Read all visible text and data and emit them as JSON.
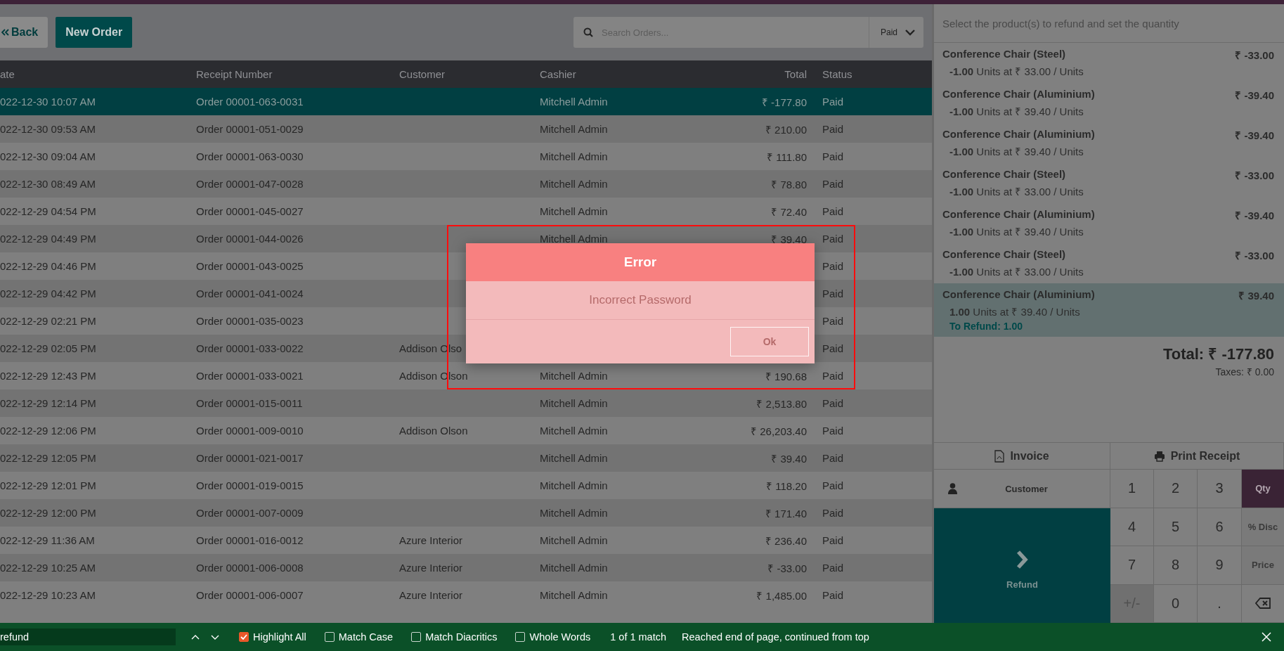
{
  "top_bar": {
    "back": "Back",
    "new_order": "New Order",
    "search": {
      "placeholder": "Search Orders..."
    },
    "filter": "Paid"
  },
  "table": {
    "columns": [
      "ate",
      "Receipt Number",
      "Customer",
      "Cashier",
      "Total",
      "Status"
    ],
    "rows": [
      {
        "date": "022-12-30 10:07 AM",
        "receipt": "Order 00001-063-0031",
        "cashier": "Mitchell Admin",
        "total": "₹ -177.80",
        "status": "Paid",
        "selected": true
      },
      {
        "date": "022-12-30 09:53 AM",
        "receipt": "Order 00001-051-0029",
        "cashier": "Mitchell Admin",
        "total": "₹ 210.00",
        "status": "Paid",
        "selected": false
      },
      {
        "date": "022-12-30 09:04 AM",
        "receipt": "Order 00001-063-0030",
        "cashier": "Mitchell Admin",
        "total": "₹ 111.80",
        "status": "Paid",
        "selected": false
      },
      {
        "date": "022-12-30 08:49 AM",
        "receipt": "Order 00001-047-0028",
        "cashier": "Mitchell Admin",
        "total": "₹ 78.80",
        "status": "Paid",
        "selected": false
      },
      {
        "date": "022-12-29 04:54 PM",
        "receipt": "Order 00001-045-0027",
        "cashier": "Mitchell Admin",
        "total": "₹ 72.40",
        "status": "Paid",
        "selected": false
      },
      {
        "date": "022-12-29 04:49 PM",
        "receipt": "Order 00001-044-0026",
        "cashier": "Mitchell Admin",
        "total": "₹ 39.40",
        "status": "Paid",
        "selected": false
      },
      {
        "date": "022-12-29 04:46 PM",
        "receipt": "Order 00001-043-0025",
        "status": "Paid",
        "selected": false
      },
      {
        "date": "022-12-29 04:42 PM",
        "receipt": "Order 00001-041-0024",
        "status": "Paid",
        "selected": false
      },
      {
        "date": "022-12-29 02:21 PM",
        "receipt": "Order 00001-035-0023",
        "status": "Paid",
        "selected": false
      },
      {
        "date": "022-12-29 02:05 PM",
        "receipt": "Order 00001-033-0022",
        "customer": "Addison Olso",
        "status": "Paid",
        "selected": false
      },
      {
        "date": "022-12-29 12:43 PM",
        "receipt": "Order 00001-033-0021",
        "customer": "Addison Olson",
        "cashier": "Mitchell Admin",
        "total": "₹ 190.68",
        "status": "Paid",
        "selected": false
      },
      {
        "date": "022-12-29 12:14 PM",
        "receipt": "Order 00001-015-0011",
        "cashier": "Mitchell Admin",
        "total": "₹ 2,513.80",
        "status": "Paid",
        "selected": false
      },
      {
        "date": "022-12-29 12:06 PM",
        "receipt": "Order 00001-009-0010",
        "customer": "Addison Olson",
        "cashier": "Mitchell Admin",
        "total": "₹ 26,203.40",
        "status": "Paid",
        "selected": false
      },
      {
        "date": "022-12-29 12:05 PM",
        "receipt": "Order 00001-021-0017",
        "cashier": "Mitchell Admin",
        "total": "₹ 39.40",
        "status": "Paid",
        "selected": false
      },
      {
        "date": "022-12-29 12:01 PM",
        "receipt": "Order 00001-019-0015",
        "cashier": "Mitchell Admin",
        "total": "₹ 118.20",
        "status": "Paid",
        "selected": false
      },
      {
        "date": "022-12-29 12:00 PM",
        "receipt": "Order 00001-007-0009",
        "cashier": "Mitchell Admin",
        "total": "₹ 171.40",
        "status": "Paid",
        "selected": false
      },
      {
        "date": "022-12-29 11:36 AM",
        "receipt": "Order 00001-016-0012",
        "customer": "Azure Interior",
        "cashier": "Mitchell Admin",
        "total": "₹ 236.40",
        "status": "Paid",
        "selected": false
      },
      {
        "date": "022-12-29 10:25 AM",
        "receipt": "Order 00001-006-0008",
        "customer": "Azure Interior",
        "cashier": "Mitchell Admin",
        "total": "₹ -33.00",
        "status": "Paid",
        "selected": false
      },
      {
        "date": "022-12-29 10:23 AM",
        "receipt": "Order 00001-006-0007",
        "customer": "Azure Interior",
        "cashier": "Mitchell Admin",
        "total": "₹ 1,485.00",
        "status": "Paid",
        "selected": false
      }
    ]
  },
  "dialog": {
    "title": "Error",
    "body": "Incorrect Password",
    "button": "Ok"
  },
  "refund_panel": {
    "instruction": "Select the product(s) to refund and set the quantity",
    "lines": [
      {
        "product": "Conference Chair (Steel)",
        "price": "₹ -33.00",
        "detail": "**-1.00** Units at ₹ 33.00 / Units",
        "selected": false
      },
      {
        "product": "Conference Chair (Aluminium)",
        "price": "₹ -39.40",
        "detail": "**-1.00** Units at ₹ 39.40 / Units",
        "selected": false
      },
      {
        "product": "Conference Chair (Aluminium)",
        "price": "₹ -39.40",
        "detail": "**-1.00** Units at ₹ 39.40 / Units",
        "selected": false
      },
      {
        "product": "Conference Chair (Steel)",
        "price": "₹ -33.00",
        "detail": "**-1.00** Units at ₹ 33.00 / Units",
        "selected": false
      },
      {
        "product": "Conference Chair (Aluminium)",
        "price": "₹ -39.40",
        "detail": "**-1.00** Units at ₹ 39.40 / Units",
        "selected": false
      },
      {
        "product": "Conference Chair (Steel)",
        "price": "₹ -33.00",
        "detail": "**-1.00** Units at ₹ 33.00 / Units",
        "selected": false
      },
      {
        "product": "Conference Chair (Aluminium)",
        "price": "₹ 39.40",
        "detail": "**1.00** Units at ₹ 39.40 / Units",
        "to_refund": "To Refund: 1.00",
        "selected": true
      }
    ],
    "total": "Total: ₹ -177.80",
    "taxes": "Taxes: ₹ 0.00",
    "invoice": "Invoice",
    "print_receipt": "Print Receipt",
    "customer": "Customer",
    "refund": "Refund",
    "keys": [
      {
        "kind": "digit",
        "label": "1"
      },
      {
        "kind": "digit",
        "label": "2"
      },
      {
        "kind": "digit",
        "label": "3"
      },
      {
        "kind": "mode",
        "label": "Qty",
        "selected": true
      },
      {
        "kind": "digit",
        "label": "4"
      },
      {
        "kind": "digit",
        "label": "5"
      },
      {
        "kind": "digit",
        "label": "6"
      },
      {
        "kind": "mode",
        "label": "% Disc",
        "selected": false
      },
      {
        "kind": "digit",
        "label": "7"
      },
      {
        "kind": "digit",
        "label": "8"
      },
      {
        "kind": "digit",
        "label": "9"
      },
      {
        "kind": "mode",
        "label": "Price",
        "selected": false
      },
      {
        "kind": "sign",
        "label": "+/-"
      },
      {
        "kind": "digit",
        "label": "0"
      },
      {
        "kind": "digit",
        "label": "."
      },
      {
        "kind": "backspace"
      }
    ]
  },
  "find_bar": {
    "query": "refund",
    "options": [
      {
        "label": "Highlight All",
        "checked": true
      },
      {
        "label": "Match Case",
        "checked": false
      },
      {
        "label": "Match Diacritics",
        "checked": false
      },
      {
        "label": "Whole Words",
        "checked": false
      }
    ],
    "matches": "1 of 1 match",
    "message": "Reached end of page, continued from top"
  }
}
